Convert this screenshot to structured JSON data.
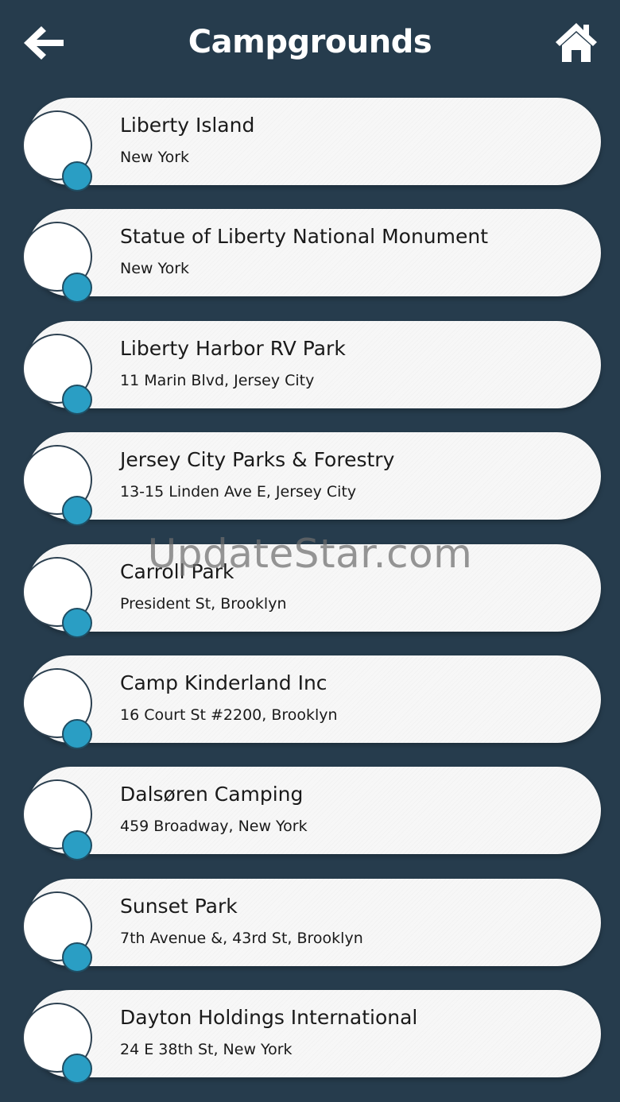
{
  "header": {
    "title": "Campgrounds",
    "back_icon": "arrow-left-icon",
    "home_icon": "home-icon"
  },
  "colors": {
    "background": "#263c4d",
    "card": "#f7f7f7",
    "accent_dot": "#2a9ec4",
    "text": "#1a1a1a"
  },
  "campgrounds": [
    {
      "name": "Liberty Island",
      "address": "New York"
    },
    {
      "name": "Statue of Liberty National Monument",
      "address": "New York"
    },
    {
      "name": "Liberty Harbor RV Park",
      "address": "11 Marin Blvd, Jersey City"
    },
    {
      "name": "Jersey City Parks & Forestry",
      "address": "13-15 Linden Ave E, Jersey City"
    },
    {
      "name": "Carroll Park",
      "address": "President St, Brooklyn"
    },
    {
      "name": "Camp Kinderland Inc",
      "address": "16 Court St #2200, Brooklyn"
    },
    {
      "name": "Dalsøren Camping",
      "address": "459 Broadway, New York"
    },
    {
      "name": "Sunset Park",
      "address": "7th Avenue &, 43rd St, Brooklyn"
    },
    {
      "name": "Dayton Holdings International",
      "address": "24 E 38th St, New York"
    }
  ],
  "watermark": "UpdateStar.com"
}
